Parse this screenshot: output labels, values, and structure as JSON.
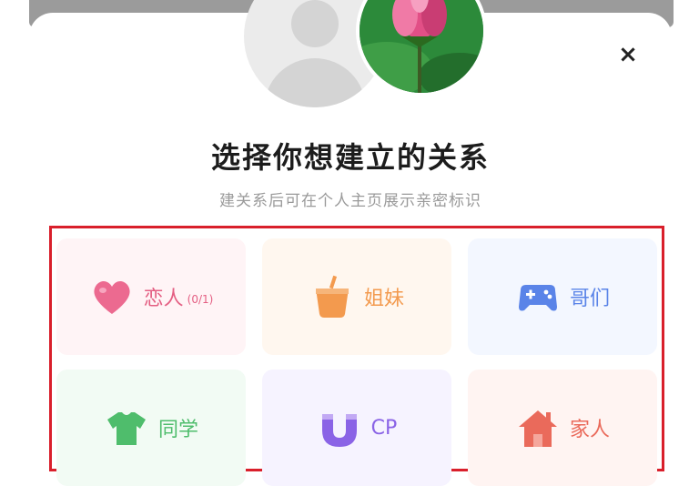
{
  "dialog": {
    "title": "选择你想建立的关系",
    "subtitle": "建关系后可在个人主页展示亲密标识",
    "close_label": "×"
  },
  "relations": [
    {
      "label": "恋人",
      "count": "(0/1)",
      "icon": "heart-icon"
    },
    {
      "label": "姐妹",
      "count": "",
      "icon": "drink-cup-icon"
    },
    {
      "label": "哥们",
      "count": "",
      "icon": "gamepad-icon"
    },
    {
      "label": "同学",
      "count": "",
      "icon": "tshirt-icon"
    },
    {
      "label": "CP",
      "count": "",
      "icon": "magnet-icon"
    },
    {
      "label": "家人",
      "count": "",
      "icon": "house-icon"
    }
  ],
  "colors": {
    "highlight_border": "#d91f2b",
    "lover": "#e45f83",
    "sister": "#f39a4e",
    "bro": "#5a84e8",
    "classmate": "#4fbd6c",
    "cp": "#8a63e6",
    "family": "#ea6a5b"
  }
}
